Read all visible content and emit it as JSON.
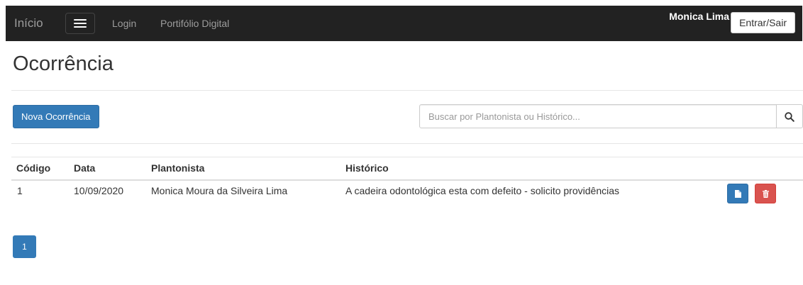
{
  "navbar": {
    "brand": "Início",
    "links": [
      "Login",
      "Portifólio Digital"
    ],
    "user_name": "Monica Lima",
    "auth_button": "Entrar/Sair",
    "background": "#222222"
  },
  "page": {
    "title": "Ocorrência",
    "new_button": "Nova Ocorrência",
    "search": {
      "placeholder": "Buscar por Plantonista ou Histórico...",
      "value": "",
      "icon": "search-icon"
    }
  },
  "table": {
    "columns": [
      "Código",
      "Data",
      "Plantonista",
      "Histórico"
    ],
    "rows": [
      {
        "codigo": "1",
        "data": "10/09/2020",
        "plantonista": "Monica Moura da Silveira Lima",
        "historico": "A cadeira odontológica esta com defeito - solicito providências",
        "actions": [
          "document-icon",
          "trash-icon"
        ]
      }
    ]
  },
  "pagination": {
    "current": "1"
  },
  "colors": {
    "primary": "#337ab7",
    "danger": "#d9534f"
  }
}
